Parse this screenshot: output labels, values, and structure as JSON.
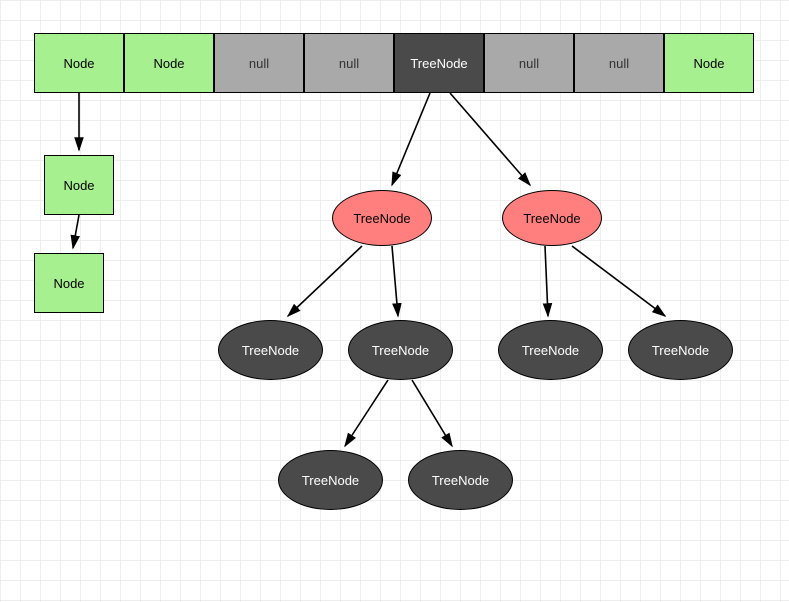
{
  "array": {
    "cells": [
      {
        "label": "Node",
        "kind": "node"
      },
      {
        "label": "Node",
        "kind": "node"
      },
      {
        "label": "null",
        "kind": "null"
      },
      {
        "label": "null",
        "kind": "null"
      },
      {
        "label": "TreeNode",
        "kind": "tree"
      },
      {
        "label": "null",
        "kind": "null"
      },
      {
        "label": "null",
        "kind": "null"
      },
      {
        "label": "Node",
        "kind": "node"
      }
    ]
  },
  "chain": {
    "nodes": [
      {
        "label": "Node"
      },
      {
        "label": "Node"
      }
    ]
  },
  "tree": {
    "level1": [
      {
        "label": "TreeNode"
      },
      {
        "label": "TreeNode"
      }
    ],
    "level2": [
      {
        "label": "TreeNode"
      },
      {
        "label": "TreeNode"
      },
      {
        "label": "TreeNode"
      },
      {
        "label": "TreeNode"
      }
    ],
    "level3": [
      {
        "label": "TreeNode"
      },
      {
        "label": "TreeNode"
      }
    ]
  },
  "colors": {
    "node_fill": "#a7f08f",
    "null_fill": "#a9a9a9",
    "treecell_fill": "#4a4a4a",
    "red_fill": "#ff7f7f",
    "dark_fill": "#4a4a4a"
  },
  "diagram_type": "hashmap-with-linked-list-and-red-black-tree"
}
